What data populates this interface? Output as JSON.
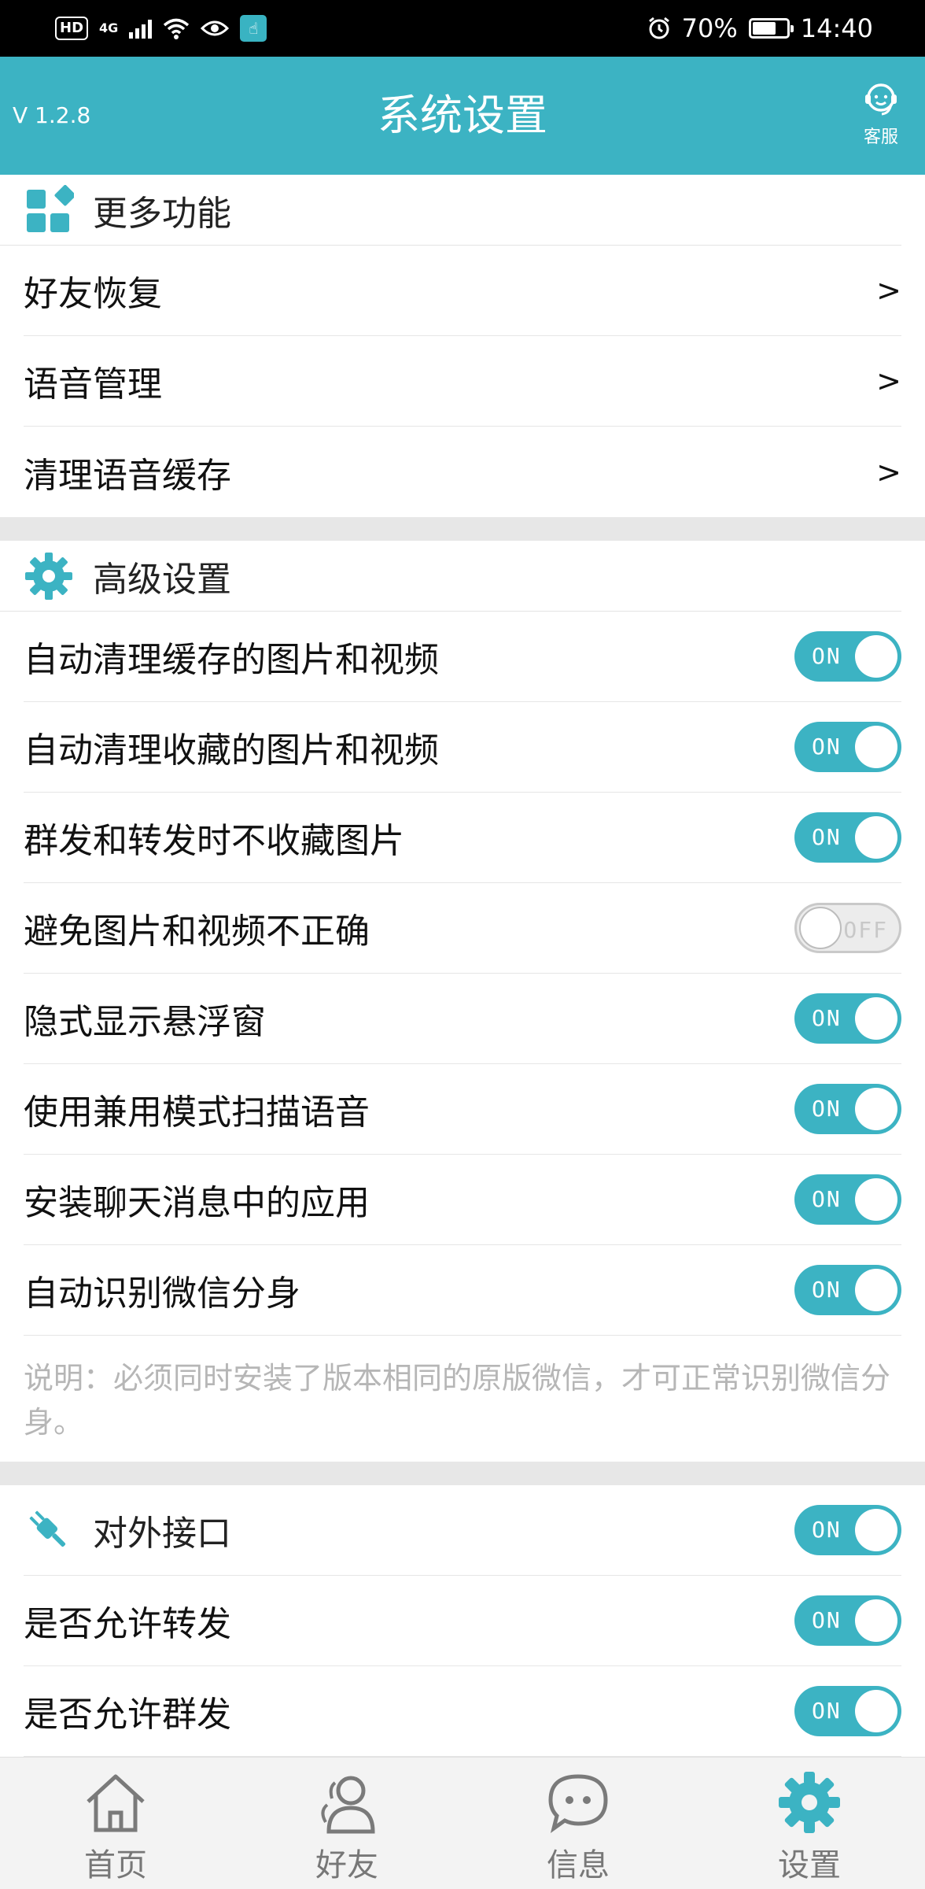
{
  "status_bar": {
    "hd": "HD",
    "network": "4G",
    "battery_pct_text": "70%",
    "battery_level": 0.7,
    "time": "14:40"
  },
  "header": {
    "version": "V 1.2.8",
    "title": "系统设置",
    "service_label": "客服"
  },
  "sections": {
    "more": {
      "title": "更多功能",
      "items": [
        {
          "label": "好友恢复",
          "chevron": ">"
        },
        {
          "label": "语音管理",
          "chevron": ">"
        },
        {
          "label": "清理语音缓存",
          "chevron": ">"
        }
      ]
    },
    "advanced": {
      "title": "高级设置",
      "items": [
        {
          "label": "自动清理缓存的图片和视频",
          "state": "ON"
        },
        {
          "label": "自动清理收藏的图片和视频",
          "state": "ON"
        },
        {
          "label": "群发和转发时不收藏图片",
          "state": "ON"
        },
        {
          "label": "避免图片和视频不正确",
          "state": "OFF"
        },
        {
          "label": "隐式显示悬浮窗",
          "state": "ON"
        },
        {
          "label": "使用兼用模式扫描语音",
          "state": "ON"
        },
        {
          "label": "安装聊天消息中的应用",
          "state": "ON"
        },
        {
          "label": "自动识别微信分身",
          "state": "ON"
        }
      ],
      "note": "说明：必须同时安装了版本相同的原版微信，才可正常识别微信分身。"
    },
    "api": {
      "title": "对外接口",
      "title_state": "ON",
      "items": [
        {
          "label": "是否允许转发",
          "state": "ON"
        },
        {
          "label": "是否允许群发",
          "state": "ON"
        }
      ]
    }
  },
  "bottom_nav": [
    {
      "label": "首页",
      "icon": "home-icon",
      "active": false
    },
    {
      "label": "好友",
      "icon": "friends-icon",
      "active": false
    },
    {
      "label": "信息",
      "icon": "message-icon",
      "active": false
    },
    {
      "label": "设置",
      "icon": "settings-icon",
      "active": true
    }
  ],
  "colors": {
    "accent": "#3cb3c3",
    "off_track": "#ececec",
    "nav_bg": "#f3f3f3"
  }
}
